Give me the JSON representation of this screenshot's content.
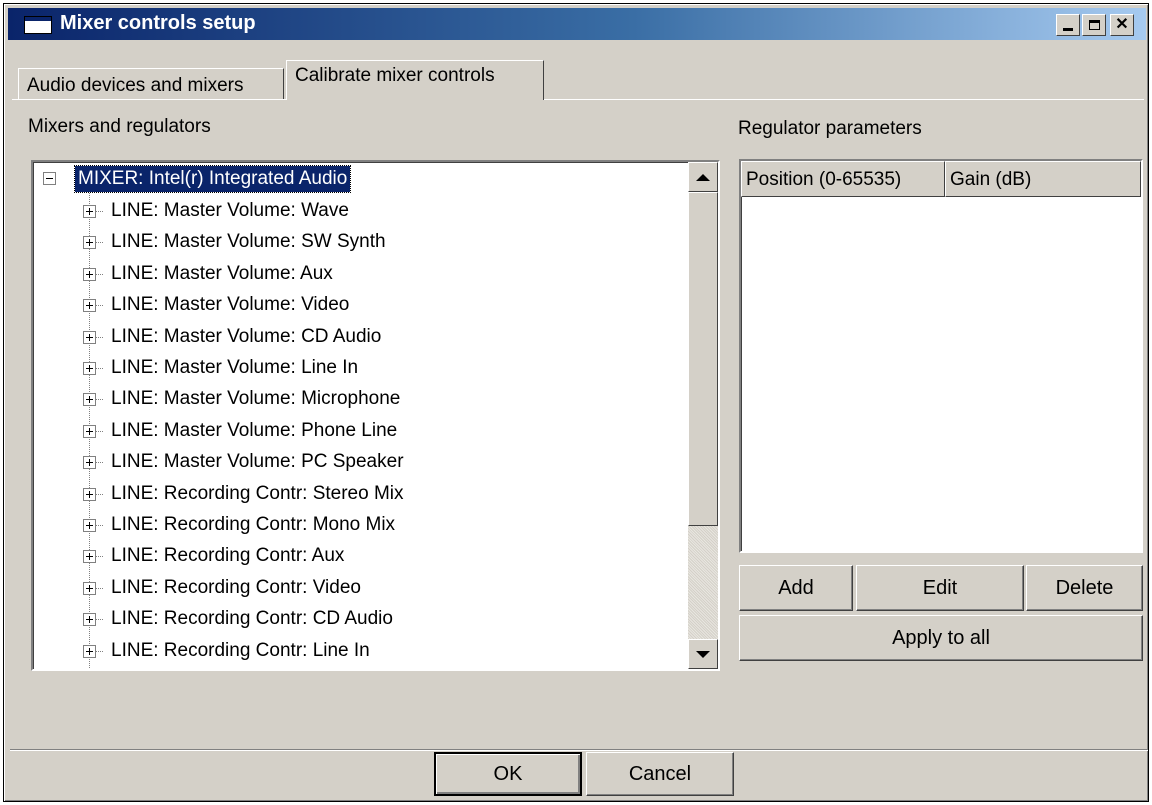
{
  "window": {
    "title": "Mixer controls setup",
    "icons": {
      "app": "app-window-icon",
      "minimize": "minimize-icon",
      "maximize": "maximize-icon",
      "close": "close-icon"
    },
    "close_glyph": "✕"
  },
  "tabs": [
    {
      "label": "Audio devices and mixers",
      "active": false
    },
    {
      "label": "Calibrate mixer controls",
      "active": true
    }
  ],
  "left": {
    "label": "Mixers and regulators",
    "tree": {
      "root": {
        "label": "MIXER: Intel(r) Integrated Audio",
        "expanded": true,
        "selected": true
      },
      "children": [
        "LINE: Master Volume: Wave",
        "LINE: Master Volume: SW Synth",
        "LINE: Master Volume: Aux",
        "LINE: Master Volume: Video",
        "LINE: Master Volume: CD Audio",
        "LINE: Master Volume: Line In",
        "LINE: Master Volume: Microphone",
        "LINE: Master Volume: Phone Line",
        "LINE: Master Volume: PC Speaker",
        "LINE: Recording Contr: Stereo Mix",
        "LINE: Recording Contr: Mono Mix",
        "LINE: Recording Contr: Aux",
        "LINE: Recording Contr: Video",
        "LINE: Recording Contr: CD Audio",
        "LINE: Recording Contr: Line In"
      ]
    }
  },
  "right": {
    "label": "Regulator parameters",
    "columns": [
      "Position (0-65535)",
      "Gain (dB)"
    ],
    "rows": [],
    "buttons": {
      "add": "Add",
      "edit": "Edit",
      "delete": "Delete",
      "apply_all": "Apply to all"
    }
  },
  "footer": {
    "ok": "OK",
    "cancel": "Cancel"
  },
  "colors": {
    "face": "#d4d0c8",
    "title_start": "#0a246a",
    "title_end": "#a6caf0",
    "selection": "#0a246a"
  }
}
